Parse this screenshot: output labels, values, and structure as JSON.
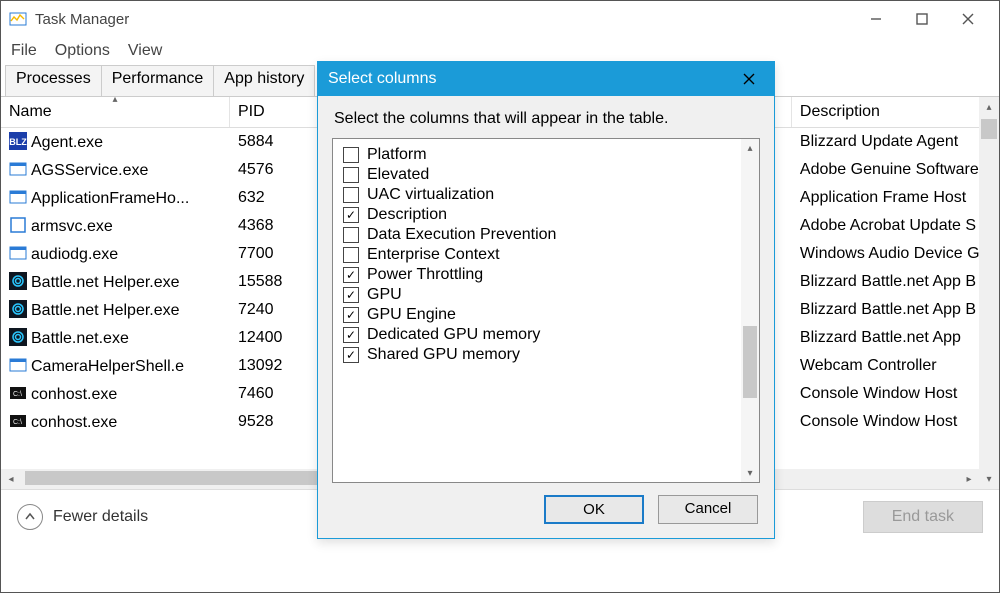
{
  "window": {
    "title": "Task Manager",
    "minimize": "—",
    "maximize": "□",
    "close": "✕"
  },
  "menubar": [
    "File",
    "Options",
    "View"
  ],
  "tabs": [
    "Processes",
    "Performance",
    "App history"
  ],
  "columns": {
    "name": "Name",
    "pid": "PID",
    "description": "Description"
  },
  "rows": [
    {
      "name": "Agent.exe",
      "pid": "5884",
      "desc": "Blizzard Update Agent",
      "icon": "blz"
    },
    {
      "name": "AGSService.exe",
      "pid": "4576",
      "desc": "Adobe Genuine Software",
      "icon": "win"
    },
    {
      "name": "ApplicationFrameHo...",
      "pid": "632",
      "desc": "Application Frame Host",
      "icon": "win"
    },
    {
      "name": "armsvc.exe",
      "pid": "4368",
      "desc": "Adobe Acrobat Update S",
      "icon": "box"
    },
    {
      "name": "audiodg.exe",
      "pid": "7700",
      "desc": "Windows Audio Device G",
      "icon": "win"
    },
    {
      "name": "Battle.net Helper.exe",
      "pid": "15588",
      "desc": "Blizzard Battle.net App B",
      "icon": "bn"
    },
    {
      "name": "Battle.net Helper.exe",
      "pid": "7240",
      "desc": "Blizzard Battle.net App B",
      "icon": "bn"
    },
    {
      "name": "Battle.net.exe",
      "pid": "12400",
      "desc": "Blizzard Battle.net App",
      "icon": "bn"
    },
    {
      "name": "CameraHelperShell.e",
      "pid": "13092",
      "desc": "Webcam Controller",
      "icon": "win"
    },
    {
      "name": "conhost.exe",
      "pid": "7460",
      "desc": "Console Window Host",
      "icon": "con"
    },
    {
      "name": "conhost.exe",
      "pid": "9528",
      "desc": "Console Window Host",
      "icon": "con"
    }
  ],
  "footer": {
    "fewer": "Fewer details",
    "end": "End task"
  },
  "dialog": {
    "title": "Select columns",
    "instruction": "Select the columns that will appear in the table.",
    "items": [
      {
        "label": "Platform",
        "checked": false
      },
      {
        "label": "Elevated",
        "checked": false
      },
      {
        "label": "UAC virtualization",
        "checked": false
      },
      {
        "label": "Description",
        "checked": true
      },
      {
        "label": "Data Execution Prevention",
        "checked": false
      },
      {
        "label": "Enterprise Context",
        "checked": false
      },
      {
        "label": "Power Throttling",
        "checked": true
      },
      {
        "label": "GPU",
        "checked": true
      },
      {
        "label": "GPU Engine",
        "checked": true
      },
      {
        "label": "Dedicated GPU memory",
        "checked": true
      },
      {
        "label": "Shared GPU memory",
        "checked": true
      }
    ],
    "ok": "OK",
    "cancel": "Cancel"
  }
}
